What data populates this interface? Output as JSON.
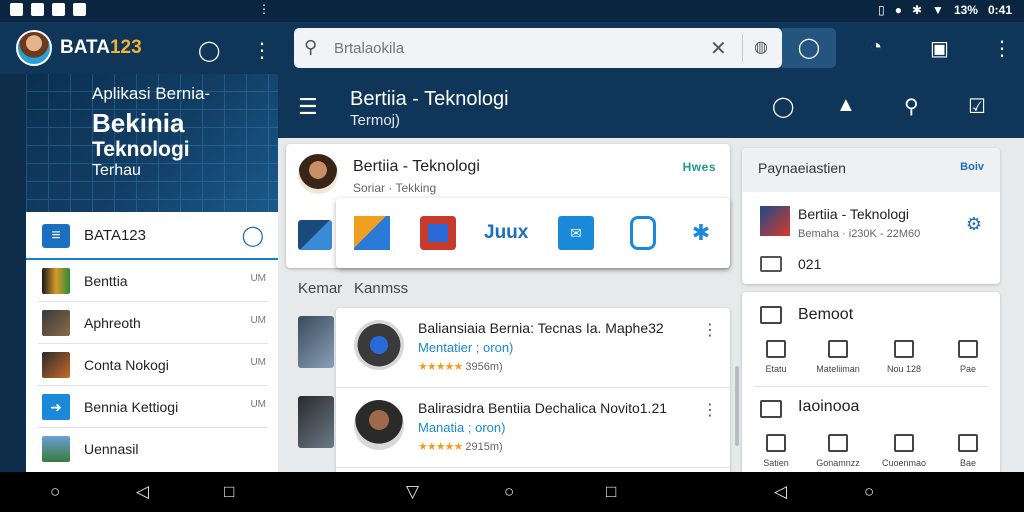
{
  "status_bar": {
    "battery_text": "13%",
    "time": "0:41"
  },
  "drawer_header": {
    "brand_main": "BATA",
    "brand_num": "123"
  },
  "hero": {
    "line1": "Aplikasi Bernia-",
    "line2": "Bekinia",
    "line3": "Teknologi",
    "line4": "Terhau"
  },
  "drawer": {
    "title": "BATA123",
    "items": [
      {
        "label": "Benttia",
        "meta": "UM"
      },
      {
        "label": "Aphreoth",
        "meta": "UM"
      },
      {
        "label": "Conta Nokogi",
        "meta": "UM"
      },
      {
        "label": "Bennia Kettiogi",
        "meta": "UM"
      },
      {
        "label": "Uennasil",
        "meta": ""
      }
    ]
  },
  "search": {
    "placeholder": "Brtalaokila"
  },
  "title_bar": {
    "title": "Bertiia - Teknologi",
    "subtitle": "Termoj)"
  },
  "main_card": {
    "name": "Bertiia - Teknologi",
    "subtitle": "Soriar · Tekking",
    "tag": "Hwes"
  },
  "popup": {
    "app_text": "Juux"
  },
  "section": {
    "label": "Kanmss",
    "label_b": "Kemar"
  },
  "list": [
    {
      "title": "Baliansiaia Bernia: Tecnas Ia. Maphe32",
      "subtitle": "Mentatier ; oron)",
      "stars": "★★★★★",
      "rating": "3956m)"
    },
    {
      "title": "Balirasidra Bentiia Dechalica Novito1.21",
      "subtitle": "Manatia ; oron)",
      "stars": "★★★★★",
      "rating": "2915m)"
    }
  ],
  "right_card1": {
    "header": "Paynaeiastien",
    "badge": "Boiv",
    "name": "Bertiia - Teknologi",
    "meta": "Bemaha · i230K - 22M60",
    "number": "021"
  },
  "right_card2": {
    "section1_title": "Bemoot",
    "section1_tiles": [
      "Etatu",
      "Mateliiman",
      "Nou 128",
      "Pae"
    ],
    "section2_title": "Iaoinooa",
    "section2_tiles": [
      "Satien",
      "Gonamnzz",
      "Cuoenmao",
      "Bae"
    ]
  },
  "colors": {
    "primary": "#0f3558",
    "accent": "#1a6fc0",
    "background": "#e7e9eb"
  }
}
